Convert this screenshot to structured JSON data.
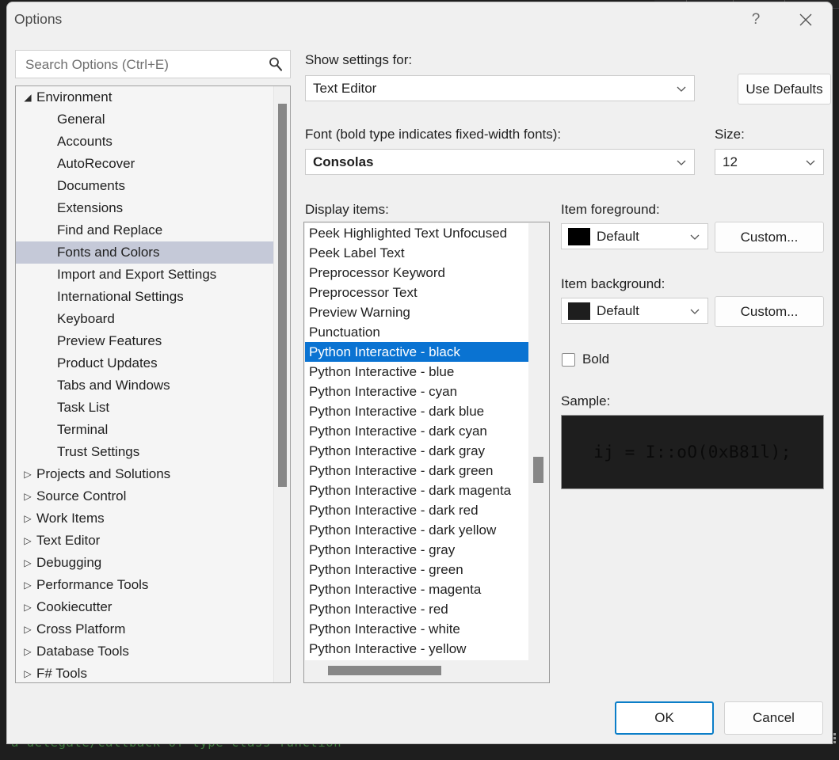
{
  "window": {
    "title": "Options",
    "help_icon": "?",
    "help_tooltip": "Help",
    "close_icon": "close-icon"
  },
  "search": {
    "placeholder": "Search Options (Ctrl+E)",
    "value": "",
    "icon": "search-icon"
  },
  "tree": {
    "selected": "Fonts and Colors",
    "items": [
      {
        "label": "Environment",
        "level": 0,
        "twisty": "expanded",
        "selected": false
      },
      {
        "label": "General",
        "level": 1,
        "twisty": "none",
        "selected": false
      },
      {
        "label": "Accounts",
        "level": 1,
        "twisty": "none",
        "selected": false
      },
      {
        "label": "AutoRecover",
        "level": 1,
        "twisty": "none",
        "selected": false
      },
      {
        "label": "Documents",
        "level": 1,
        "twisty": "none",
        "selected": false
      },
      {
        "label": "Extensions",
        "level": 1,
        "twisty": "none",
        "selected": false
      },
      {
        "label": "Find and Replace",
        "level": 1,
        "twisty": "none",
        "selected": false
      },
      {
        "label": "Fonts and Colors",
        "level": 1,
        "twisty": "none",
        "selected": true
      },
      {
        "label": "Import and Export Settings",
        "level": 1,
        "twisty": "none",
        "selected": false
      },
      {
        "label": "International Settings",
        "level": 1,
        "twisty": "none",
        "selected": false
      },
      {
        "label": "Keyboard",
        "level": 1,
        "twisty": "none",
        "selected": false
      },
      {
        "label": "Preview Features",
        "level": 1,
        "twisty": "none",
        "selected": false
      },
      {
        "label": "Product Updates",
        "level": 1,
        "twisty": "none",
        "selected": false
      },
      {
        "label": "Tabs and Windows",
        "level": 1,
        "twisty": "none",
        "selected": false
      },
      {
        "label": "Task List",
        "level": 1,
        "twisty": "none",
        "selected": false
      },
      {
        "label": "Terminal",
        "level": 1,
        "twisty": "none",
        "selected": false
      },
      {
        "label": "Trust Settings",
        "level": 1,
        "twisty": "none",
        "selected": false
      },
      {
        "label": "Projects and Solutions",
        "level": 0,
        "twisty": "collapsed",
        "selected": false
      },
      {
        "label": "Source Control",
        "level": 0,
        "twisty": "collapsed",
        "selected": false
      },
      {
        "label": "Work Items",
        "level": 0,
        "twisty": "collapsed",
        "selected": false
      },
      {
        "label": "Text Editor",
        "level": 0,
        "twisty": "collapsed",
        "selected": false
      },
      {
        "label": "Debugging",
        "level": 0,
        "twisty": "collapsed",
        "selected": false
      },
      {
        "label": "Performance Tools",
        "level": 0,
        "twisty": "collapsed",
        "selected": false
      },
      {
        "label": "Cookiecutter",
        "level": 0,
        "twisty": "collapsed",
        "selected": false
      },
      {
        "label": "Cross Platform",
        "level": 0,
        "twisty": "collapsed",
        "selected": false
      },
      {
        "label": "Database Tools",
        "level": 0,
        "twisty": "collapsed",
        "selected": false
      },
      {
        "label": "F# Tools",
        "level": 0,
        "twisty": "collapsed",
        "selected": false
      }
    ]
  },
  "settings": {
    "show_settings_label": "Show settings for:",
    "show_settings_value": "Text Editor",
    "use_defaults_label": "Use Defaults",
    "font_label": "Font (bold type indicates fixed-width fonts):",
    "font_value": "Consolas",
    "size_label": "Size:",
    "size_value": "12"
  },
  "display_items": {
    "label": "Display items:",
    "selected": "Python Interactive - black",
    "items": [
      {
        "label": "Peek Highlighted Text Unfocused",
        "selected": false
      },
      {
        "label": "Peek Label Text",
        "selected": false
      },
      {
        "label": "Preprocessor Keyword",
        "selected": false
      },
      {
        "label": "Preprocessor Text",
        "selected": false
      },
      {
        "label": "Preview Warning",
        "selected": false
      },
      {
        "label": "Punctuation",
        "selected": false
      },
      {
        "label": "Python Interactive - black",
        "selected": true
      },
      {
        "label": "Python Interactive - blue",
        "selected": false
      },
      {
        "label": "Python Interactive - cyan",
        "selected": false
      },
      {
        "label": "Python Interactive - dark blue",
        "selected": false
      },
      {
        "label": "Python Interactive - dark cyan",
        "selected": false
      },
      {
        "label": "Python Interactive - dark gray",
        "selected": false
      },
      {
        "label": "Python Interactive - dark green",
        "selected": false
      },
      {
        "label": "Python Interactive - dark magenta",
        "selected": false
      },
      {
        "label": "Python Interactive - dark red",
        "selected": false
      },
      {
        "label": "Python Interactive - dark yellow",
        "selected": false
      },
      {
        "label": "Python Interactive - gray",
        "selected": false
      },
      {
        "label": "Python Interactive - green",
        "selected": false
      },
      {
        "label": "Python Interactive - magenta",
        "selected": false
      },
      {
        "label": "Python Interactive - red",
        "selected": false
      },
      {
        "label": "Python Interactive - white",
        "selected": false
      },
      {
        "label": "Python Interactive - yellow",
        "selected": false
      }
    ]
  },
  "item_colors": {
    "foreground_label": "Item foreground:",
    "foreground_value": "Default",
    "foreground_swatch": "#000000",
    "foreground_custom_label": "Custom...",
    "background_label": "Item background:",
    "background_value": "Default",
    "background_swatch": "#1e1e1e",
    "background_custom_label": "Custom...",
    "bold_label": "Bold",
    "bold_checked": false
  },
  "sample": {
    "label": "Sample:",
    "text": "ij = I::oO(0xB81l);",
    "background": "#1e1e1e",
    "foreground": "#0a0a0a"
  },
  "footer": {
    "ok_label": "OK",
    "cancel_label": "Cancel"
  },
  "background_editor": {
    "code_text": "a delegate/callback of type class function",
    "code_color": "#3c7a3c"
  },
  "theme": {
    "dialog_background": "#f0f0f0",
    "selection_blue": "#0a73d2",
    "tree_selection": "#c5c9d8",
    "focus_border": "#0b7ec8"
  }
}
